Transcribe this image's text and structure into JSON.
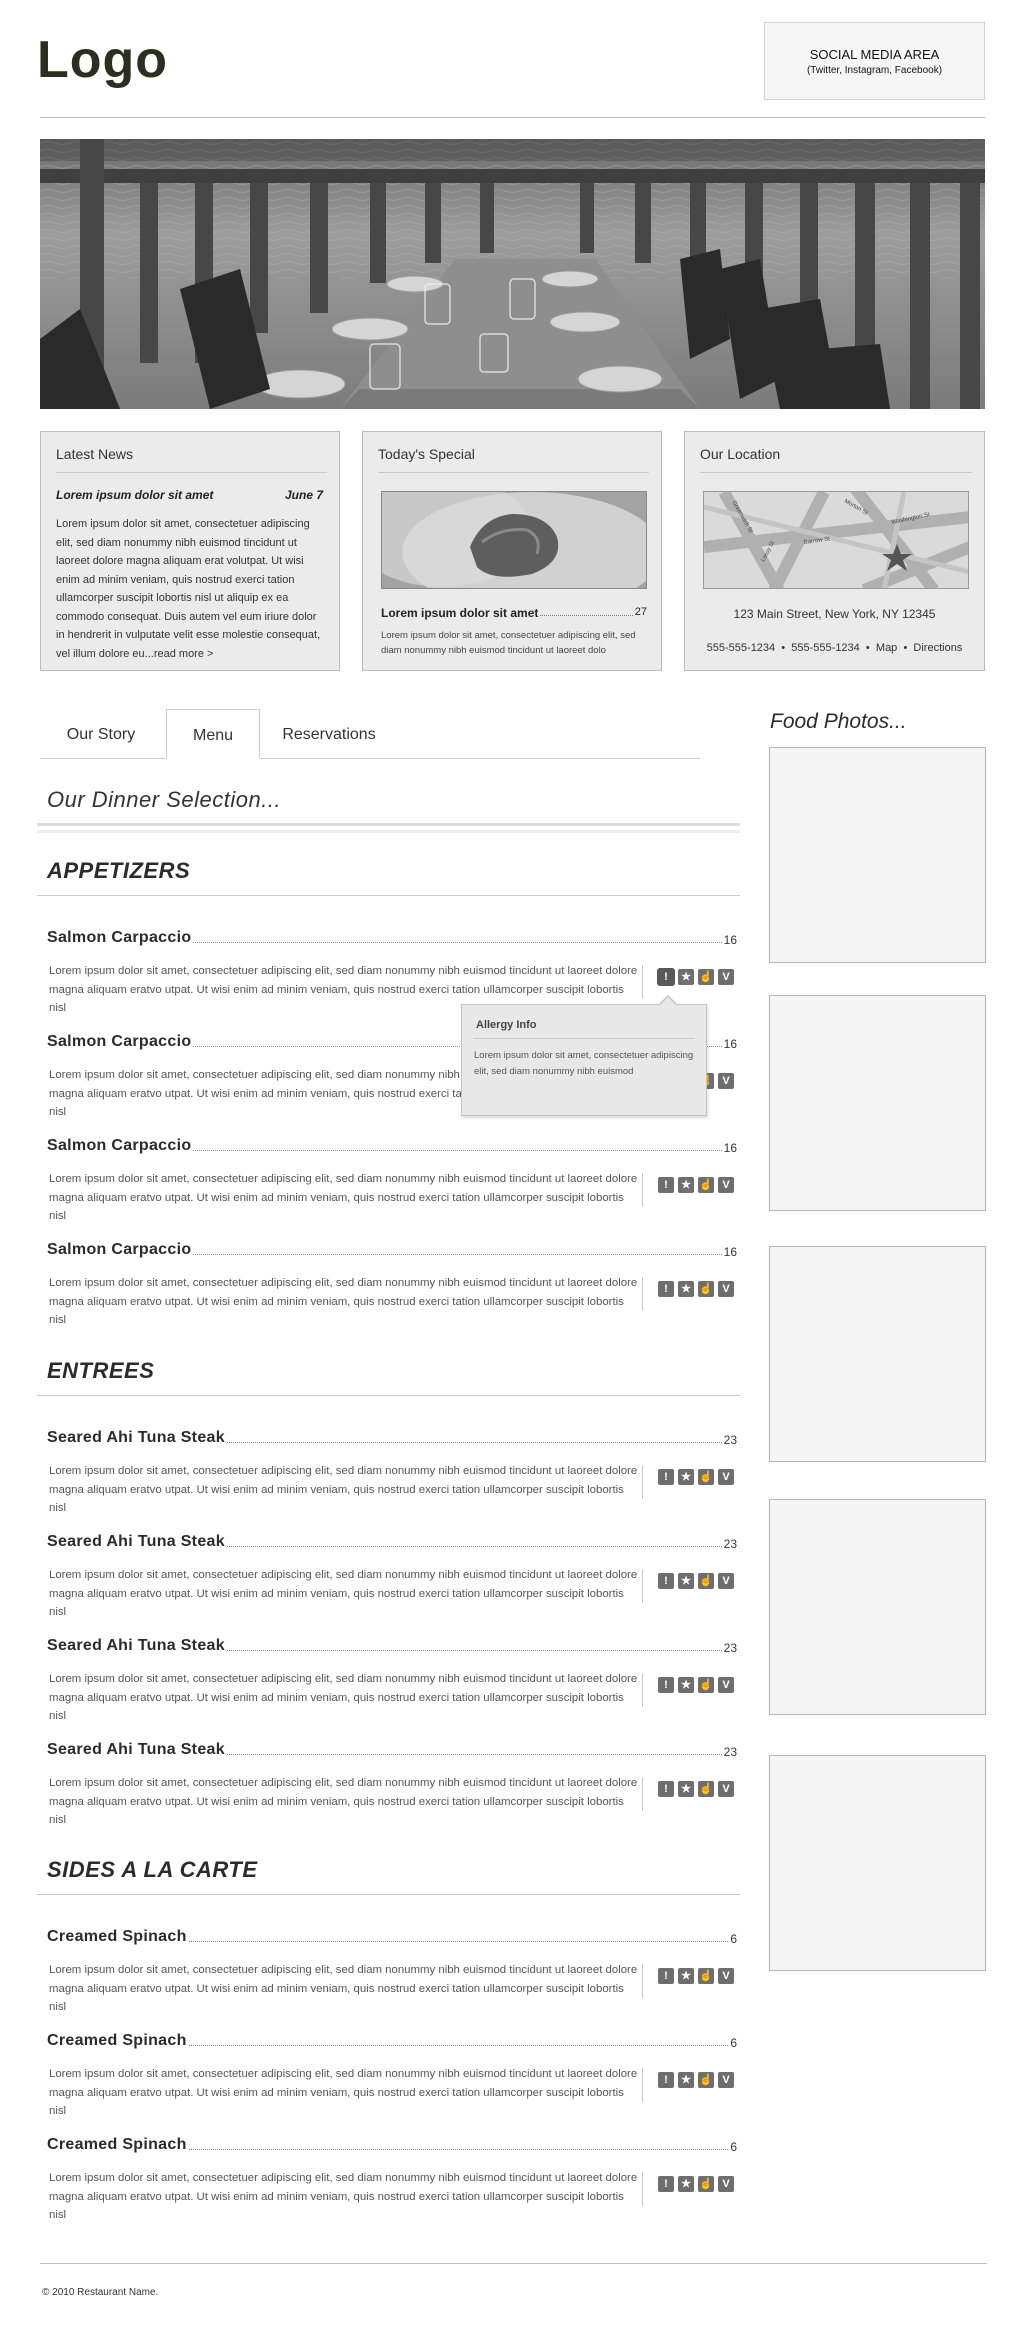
{
  "header": {
    "logo": "Logo",
    "social_title": "SOCIAL MEDIA AREA",
    "social_sub": "(Twitter, Instagram, Facebook)"
  },
  "boxes": {
    "news": {
      "title": "Latest News",
      "headline": "Lorem ipsum dolor sit amet",
      "date": "June 7",
      "body": "Lorem ipsum dolor sit amet, consectetuer adipiscing elit, sed diam nonummy nibh euismod tincidunt ut laoreet dolore magna aliquam erat volutpat. Ut wisi enim ad minim veniam, quis nostrud exerci tation ullamcorper suscipit lobortis nisl ut aliquip ex ea commodo consequat. Duis autem vel eum iriure dolor in hendrerit in vulputate velit esse molestie consequat, vel illum dolore eu...",
      "read_more": "read more >"
    },
    "special": {
      "title": "Today's Special",
      "item_name": "Lorem ipsum dolor sit amet",
      "item_price": "27",
      "body": "Lorem ipsum dolor sit amet, consectetuer adipiscing elit, sed diam nonummy nibh euismod tincidunt ut laoreet dolo"
    },
    "location": {
      "title": "Our Location",
      "address": "123 Main Street, New York, NY 12345",
      "phone1": "555-555-1234",
      "phone2": "555-555-1234",
      "map_link": "Map",
      "directions_link": "Directions",
      "sep": "•",
      "streets": [
        "Washington St",
        "Barrow St",
        "Greenwich St",
        "Leroy St",
        "Morton St"
      ]
    }
  },
  "tabs": [
    {
      "label": "Our Story"
    },
    {
      "label": "Menu"
    },
    {
      "label": "Reservations"
    }
  ],
  "menu_heading": "Our Dinner Selection...",
  "lorem": "Lorem ipsum dolor sit amet, consectetuer adipiscing elit, sed diam nonummy nibh euismod tincidunt ut laoreet dolore magna aliquam eratvo utpat. Ut wisi enim ad minim veniam, quis nostrud exerci tation ullamcorper suscipit lobortis nisl",
  "icons": [
    "!",
    "★",
    "☝",
    "V"
  ],
  "sections": [
    {
      "title": "APPETIZERS",
      "items": [
        {
          "name": "Salmon Carpaccio",
          "price": "16"
        },
        {
          "name": "Salmon Carpaccio",
          "price": "16"
        },
        {
          "name": "Salmon Carpaccio",
          "price": "16"
        },
        {
          "name": "Salmon Carpaccio",
          "price": "16"
        }
      ]
    },
    {
      "title": "ENTREES",
      "items": [
        {
          "name": "Seared Ahi Tuna Steak",
          "price": "23"
        },
        {
          "name": "Seared Ahi Tuna Steak",
          "price": "23"
        },
        {
          "name": "Seared Ahi Tuna Steak",
          "price": "23"
        },
        {
          "name": "Seared Ahi Tuna Steak",
          "price": "23"
        }
      ]
    },
    {
      "title": "SIDES A LA CARTE",
      "items": [
        {
          "name": "Creamed Spinach",
          "price": "6"
        },
        {
          "name": "Creamed Spinach",
          "price": "6"
        },
        {
          "name": "Creamed Spinach",
          "price": "6"
        }
      ]
    }
  ],
  "allergy": {
    "title": "Allergy Info",
    "body": "Lorem ipsum dolor sit amet, consectetuer adipiscing elit, sed diam nonummy nibh euismod"
  },
  "photos_title": "Food Photos...",
  "footer": {
    "copyright": "© 2010 Restaurant Name."
  }
}
